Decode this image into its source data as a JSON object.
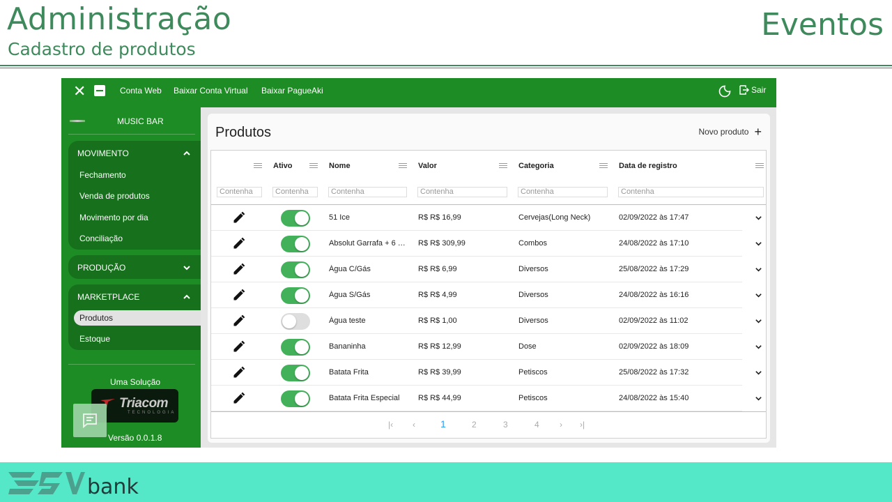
{
  "slide": {
    "title": "Administração",
    "subtitle": "Cadastro de produtos",
    "right_title": "Eventos",
    "brand": "bank"
  },
  "topbar": {
    "nav": [
      "Conta Web",
      "Baixar Conta Virtual",
      "Baixar PagueAki"
    ],
    "logout_label": "Sair"
  },
  "sidebar": {
    "venue": "MUSIC BAR",
    "sections": [
      {
        "label": "MOVIMENTO",
        "expanded": true,
        "items": [
          "Fechamento",
          "Venda de produtos",
          "Movimento por dia",
          "Conciliação"
        ]
      },
      {
        "label": "PRODUÇÃO",
        "expanded": false,
        "items": []
      },
      {
        "label": "MARKETPLACE",
        "expanded": true,
        "items": [
          "Produtos",
          "Estoque"
        ],
        "active": "Produtos"
      }
    ],
    "solution_label": "Uma Solução",
    "partner_name": "Triacom",
    "partner_tagline": "TECNOLOGIA",
    "version": "Versão 0.0.1.8"
  },
  "main": {
    "title": "Produtos",
    "new_label": "Novo produto",
    "columns": [
      "Ativo",
      "Nome",
      "Valor",
      "Categoria",
      "Data de registro"
    ],
    "filter_placeholder": "Contenha",
    "rows": [
      {
        "active": true,
        "name": "51 Ice",
        "value": "R$ R$ 16,99",
        "category": "Cervejas(Long Neck)",
        "date": "02/09/2022 às 17:47"
      },
      {
        "active": true,
        "name": "Absolut Garrafa + 6 Red Bull",
        "value": "R$ R$ 309,99",
        "category": "Combos",
        "date": "24/08/2022 às 17:10"
      },
      {
        "active": true,
        "name": "Água C/Gás",
        "value": "R$ R$ 6,99",
        "category": "Diversos",
        "date": "25/08/2022 às 17:29"
      },
      {
        "active": true,
        "name": "Água S/Gás",
        "value": "R$ R$ 4,99",
        "category": "Diversos",
        "date": "24/08/2022 às 16:16"
      },
      {
        "active": false,
        "name": "Água teste",
        "value": "R$ R$ 1,00",
        "category": "Diversos",
        "date": "02/09/2022 às 11:02"
      },
      {
        "active": true,
        "name": "Bananinha",
        "value": "R$ R$ 12,99",
        "category": "Dose",
        "date": "02/09/2022 às 18:09"
      },
      {
        "active": true,
        "name": "Batata Frita",
        "value": "R$ R$ 39,99",
        "category": "Petiscos",
        "date": "25/08/2022 às 17:32"
      },
      {
        "active": true,
        "name": "Batata Frita Especial",
        "value": "R$ R$ 44,99",
        "category": "Petiscos",
        "date": "24/08/2022 às 15:40"
      }
    ],
    "pagination": {
      "pages": [
        "1",
        "2",
        "3",
        "4"
      ],
      "current": "1"
    }
  },
  "colors": {
    "app_green": "#1e8c24",
    "section_green": "#17711c",
    "toggle_on": "#43b15a",
    "slide_text": "#3f8a5c",
    "footer_band": "#55e8c8",
    "pager_active": "#2a9df4"
  }
}
